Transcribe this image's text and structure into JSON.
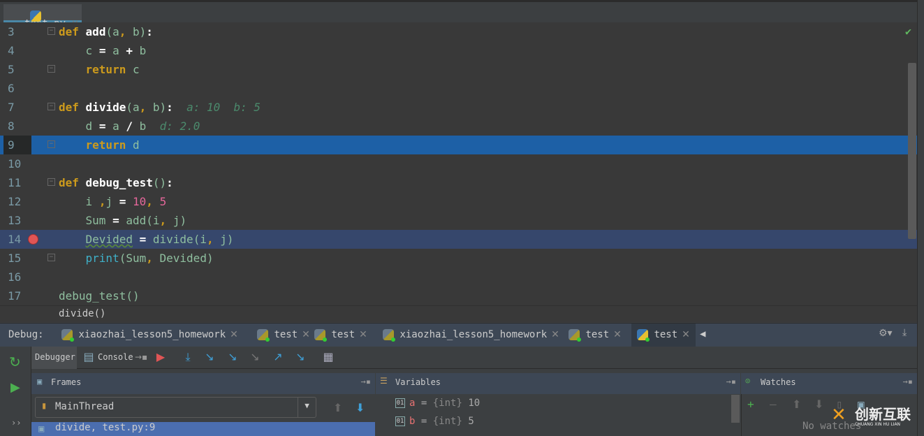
{
  "file_tab": {
    "label": "test.py"
  },
  "editor": {
    "lines": [
      {
        "n": "3",
        "html": "<span class='kw'>def</span> <span class='fn'>add</span><span class='pa'>(a</span><span class='kw'>,</span> <span class='pa'>b)</span><span class='op'>:</span>"
      },
      {
        "n": "4",
        "html": "    <span class='pa'>c</span> <span class='op'>=</span> <span class='pa'>a</span> <span class='op'>+</span> <span class='pa'>b</span>"
      },
      {
        "n": "5",
        "html": "    <span class='kw'>return</span> <span class='pa'>c</span>"
      },
      {
        "n": "6",
        "html": ""
      },
      {
        "n": "7",
        "html": "<span class='kw'>def</span> <span class='fn'>divide</span><span class='pa'>(a</span><span class='kw'>,</span> <span class='pa'>b)</span><span class='op'>:</span>  <span class='hint'>a: 10  b: 5</span>"
      },
      {
        "n": "8",
        "html": "    <span class='pa'>d</span> <span class='op'>=</span> <span class='pa'>a</span> <span class='op'>/</span> <span class='pa'>b</span>  <span class='hint'>d: 2.0</span>"
      },
      {
        "n": "9",
        "html": "    <span class='kw'>return</span> <span class='pa'>d</span>"
      },
      {
        "n": "10",
        "html": ""
      },
      {
        "n": "11",
        "html": "<span class='kw'>def</span> <span class='fn'>debug_test</span><span class='pa'>()</span><span class='op'>:</span>"
      },
      {
        "n": "12",
        "html": "    <span class='pa'>i</span> <span class='kw'>,</span><span class='pa'>j</span> <span class='op'>=</span> <span class='num'>10</span><span class='kw'>,</span> <span class='num'>5</span>"
      },
      {
        "n": "13",
        "html": "    <span class='pa'>Sum</span> <span class='op'>=</span> <span class='pa'>add(i</span><span class='kw'>,</span> <span class='pa'>j)</span>"
      },
      {
        "n": "14",
        "html": "    <span class='pa err'>Devided</span> <span class='op'>=</span> <span class='pa'>divide(i</span><span class='kw'>,</span> <span class='pa'>j)</span>"
      },
      {
        "n": "15",
        "html": "    <span class='bi'>print</span><span class='pa'>(Sum</span><span class='kw'>,</span> <span class='pa'>Devided)</span>"
      },
      {
        "n": "16",
        "html": ""
      },
      {
        "n": "17",
        "html": "<span class='pa'>debug_test()</span>"
      }
    ],
    "current_line": "9",
    "breakpoint_line": "14",
    "breadcrumb": "divide()"
  },
  "debug": {
    "label": "Debug:",
    "tabs": [
      {
        "label": "xiaozhai_lesson5_homework"
      },
      {
        "label": "test"
      },
      {
        "label": "test"
      },
      {
        "label": "xiaozhai_lesson5_homework"
      },
      {
        "label": "test"
      },
      {
        "label": "test",
        "active": true
      }
    ],
    "toolbar": {
      "debugger": "Debugger",
      "console": "Console"
    },
    "frames": {
      "title": "Frames",
      "thread": "MainThread",
      "selected_frame": "divide, test.py:9"
    },
    "variables": {
      "title": "Variables",
      "items": [
        {
          "name": "a",
          "type": "{int}",
          "value": "10"
        },
        {
          "name": "b",
          "type": "{int}",
          "value": "5"
        }
      ]
    },
    "watches": {
      "title": "Watches",
      "empty": "No watches"
    }
  },
  "watermark": {
    "text": "创新互联",
    "sub": "CHUANG XIN HU LIAN"
  }
}
